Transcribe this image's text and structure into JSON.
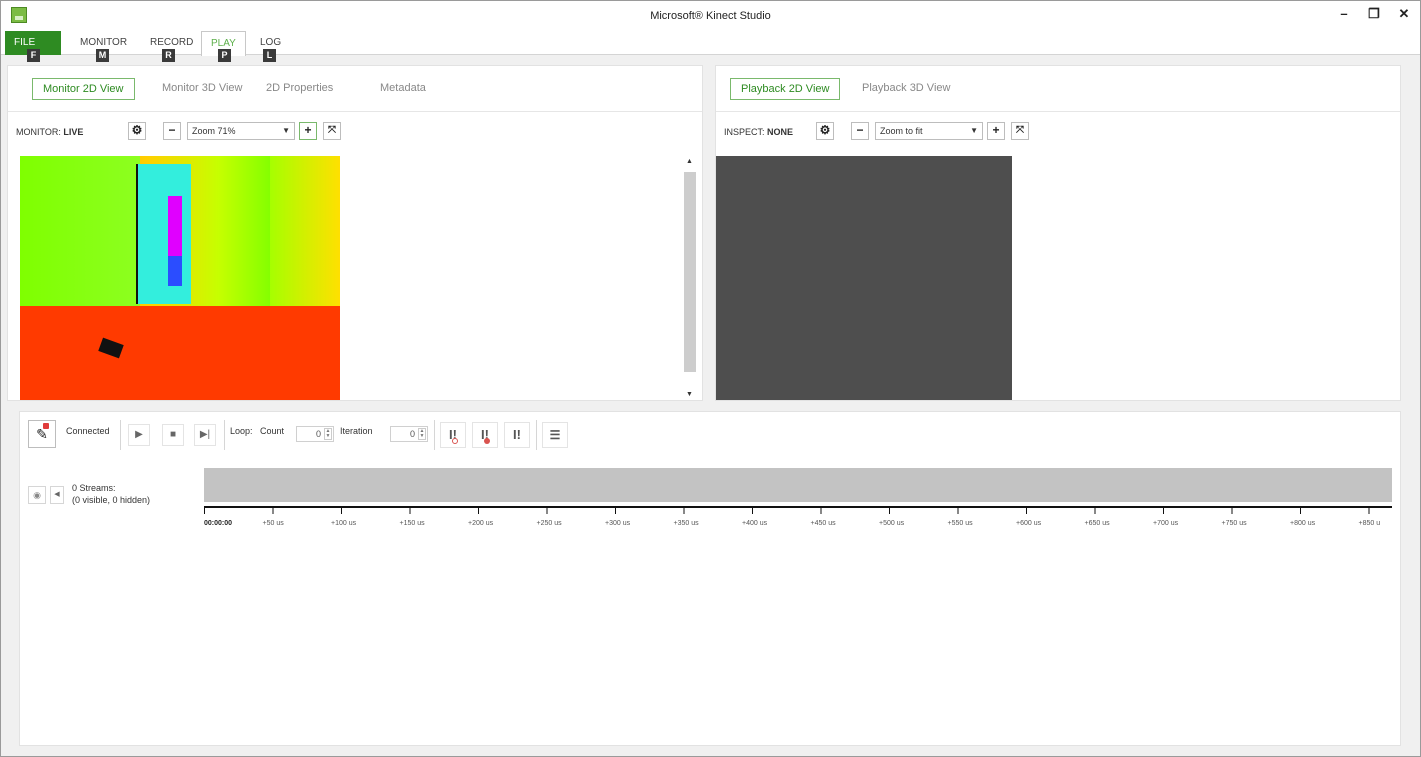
{
  "window": {
    "title": "Microsoft® Kinect Studio",
    "buttons": [
      "–",
      "❐",
      "✕"
    ]
  },
  "menu": {
    "items": [
      {
        "label": "FILE",
        "key": "F"
      },
      {
        "label": "MONITOR",
        "key": "M"
      },
      {
        "label": "RECORD",
        "key": "R"
      },
      {
        "label": "PLAY",
        "key": "P"
      },
      {
        "label": "LOG",
        "key": "L"
      }
    ],
    "active": "PLAY"
  },
  "monitor_panel": {
    "tabs": [
      "Monitor 2D View",
      "Monitor 3D View",
      "2D Properties",
      "Metadata"
    ],
    "active_tab": "Monitor 2D View",
    "label": "MONITOR:",
    "status": "LIVE",
    "zoom": "Zoom 71%"
  },
  "playback_panel": {
    "tabs": [
      "Playback 2D View",
      "Playback 3D View"
    ],
    "active_tab": "Playback 2D View",
    "label": "INSPECT:",
    "status": "NONE",
    "zoom": "Zoom to fit"
  },
  "controls": {
    "connection_status": "Connected",
    "loop_label": "Loop:",
    "count_label": "Count",
    "count_value": "0",
    "iteration_label": "Iteration",
    "iteration_value": "0"
  },
  "streams": {
    "title": "0 Streams:",
    "subtitle": "(0 visible, 0 hidden)"
  },
  "timeline": {
    "labels": [
      "00:00:00",
      "+50 us",
      "+100 us",
      "+150 us",
      "+200 us",
      "+250 us",
      "+300 us",
      "+350 us",
      "+400 us",
      "+450 us",
      "+500 us",
      "+550 us",
      "+600 us",
      "+650 us",
      "+700 us",
      "+750 us",
      "+800 us",
      "+850 u"
    ]
  },
  "colors": {
    "accent": "#2e8b22",
    "accent_light": "#5db04a",
    "playback_bg": "#4e4e4e",
    "timebar": "#c3c3c3"
  },
  "icons": {
    "settings": "gear-icon",
    "zoom_out": "minus-icon",
    "zoom_in": "plus-icon",
    "fit": "fit-screen-icon",
    "connect": "plug-icon",
    "play": "play-icon",
    "stop": "stop-icon",
    "step": "step-forward-icon",
    "visibility": "eye-icon"
  }
}
